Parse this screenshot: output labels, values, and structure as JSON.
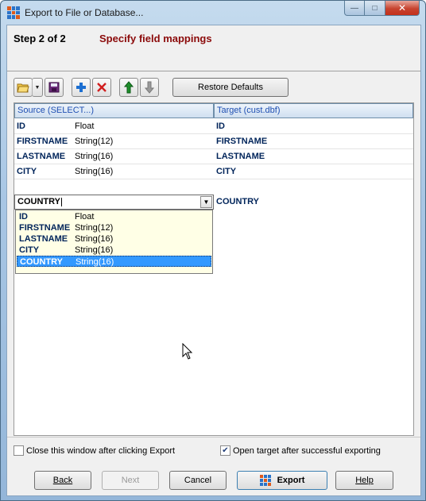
{
  "window": {
    "title": "Export to File or Database..."
  },
  "header": {
    "step": "Step 2 of 2",
    "title": "Specify field mappings"
  },
  "toolbar": {
    "icons": [
      "open-folder-icon",
      "dropdown-arrow-icon",
      "save-disk-icon",
      "add-plus-icon",
      "delete-x-icon",
      "move-up-arrow-icon",
      "move-down-arrow-icon"
    ],
    "restore_label": "Restore Defaults"
  },
  "grid": {
    "source_header": "Source (SELECT...)",
    "target_header": "Target (cust.dbf)",
    "rows": [
      {
        "field": "ID",
        "type": "Float",
        "target": "ID"
      },
      {
        "field": "FIRSTNAME",
        "type": "String(12)",
        "target": "FIRSTNAME"
      },
      {
        "field": "LASTNAME",
        "type": "String(16)",
        "target": "LASTNAME"
      },
      {
        "field": "CITY",
        "type": "String(16)",
        "target": "CITY"
      }
    ],
    "editing_row": {
      "value": "COUNTRY",
      "target": "COUNTRY"
    },
    "dropdown_items": [
      {
        "field": "ID",
        "type": "Float"
      },
      {
        "field": "FIRSTNAME",
        "type": "String(12)"
      },
      {
        "field": "LASTNAME",
        "type": "String(16)"
      },
      {
        "field": "CITY",
        "type": "String(16)"
      },
      {
        "field": "COUNTRY",
        "type": "String(16)",
        "selected": true
      }
    ]
  },
  "options": {
    "close_after_export": {
      "label": "Close this window after clicking Export",
      "checked": false
    },
    "open_target": {
      "label": "Open target after successful exporting",
      "checked": true
    }
  },
  "buttons": {
    "back": "Back",
    "next": "Next",
    "cancel": "Cancel",
    "export": "Export",
    "help": "Help"
  },
  "colors": {
    "accent_title": "#8b0a0a",
    "field_name": "#00245a",
    "selection": "#3399ff"
  }
}
